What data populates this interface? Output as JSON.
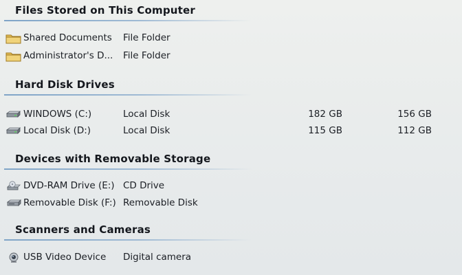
{
  "groups": {
    "files": {
      "title": "Files Stored on This Computer",
      "items": [
        {
          "name": "Shared Documents",
          "type": "File Folder",
          "icon": "folder-icon"
        },
        {
          "name": "Administrator's D...",
          "type": "File Folder",
          "icon": "folder-icon"
        }
      ]
    },
    "hdd": {
      "title": "Hard Disk Drives",
      "items": [
        {
          "name": "WINDOWS (C:)",
          "type": "Local Disk",
          "total": "182 GB",
          "free": "156 GB",
          "icon": "hard-disk-icon"
        },
        {
          "name": "Local Disk (D:)",
          "type": "Local Disk",
          "total": "115 GB",
          "free": "112 GB",
          "icon": "hard-disk-icon"
        }
      ]
    },
    "removable": {
      "title": "Devices with Removable Storage",
      "items": [
        {
          "name": "DVD-RAM Drive (E:)",
          "type": "CD Drive",
          "icon": "dvd-drive-icon"
        },
        {
          "name": "Removable Disk (F:)",
          "type": "Removable Disk",
          "icon": "removable-disk-icon"
        }
      ]
    },
    "scanners": {
      "title": "Scanners and Cameras",
      "items": [
        {
          "name": "USB Video Device",
          "type": "Digital camera",
          "icon": "webcam-icon"
        }
      ]
    }
  },
  "colors": {
    "header_rule": "#7fa4c7",
    "folder": "#e6c25a",
    "drive": "#8a9098"
  }
}
